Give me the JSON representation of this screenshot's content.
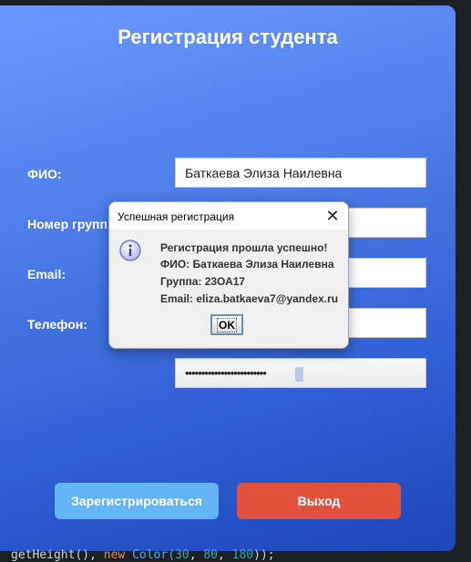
{
  "form": {
    "title": "Регистрация студента",
    "fio_label": "ФИО:",
    "fio_value": "Баткаева Элиза Наилевна",
    "group_label": "Номер группы:",
    "email_label": "Email:",
    "phone_label": "Телефон:",
    "password_mask": "•••••••••••••••••••••••••",
    "register_button": "Зарегистрироваться",
    "exit_button": "Выход"
  },
  "dialog": {
    "title": "Успешная регистрация",
    "icon": "info-icon",
    "line1": "Регистрация прошла успешно!",
    "line2": "ФИО: Баткаева Элиза Наилевна",
    "line3": "Группа: 23ОА17",
    "line4": "Email: eliza.batkaeva7@yandex.ru",
    "ok_button": "OK"
  },
  "code_background": {
    "part1": "getHeight(), ",
    "keyword": "new ",
    "class_name": "Color(",
    "n1": "30",
    "n2": "80",
    "n3": "180",
    "tail": "));"
  },
  "colors": {
    "gradient_top": "#6b98ff",
    "gradient_bottom": "#1e46b9",
    "register_button": "#64b5f6",
    "exit_button": "#e0523b"
  }
}
